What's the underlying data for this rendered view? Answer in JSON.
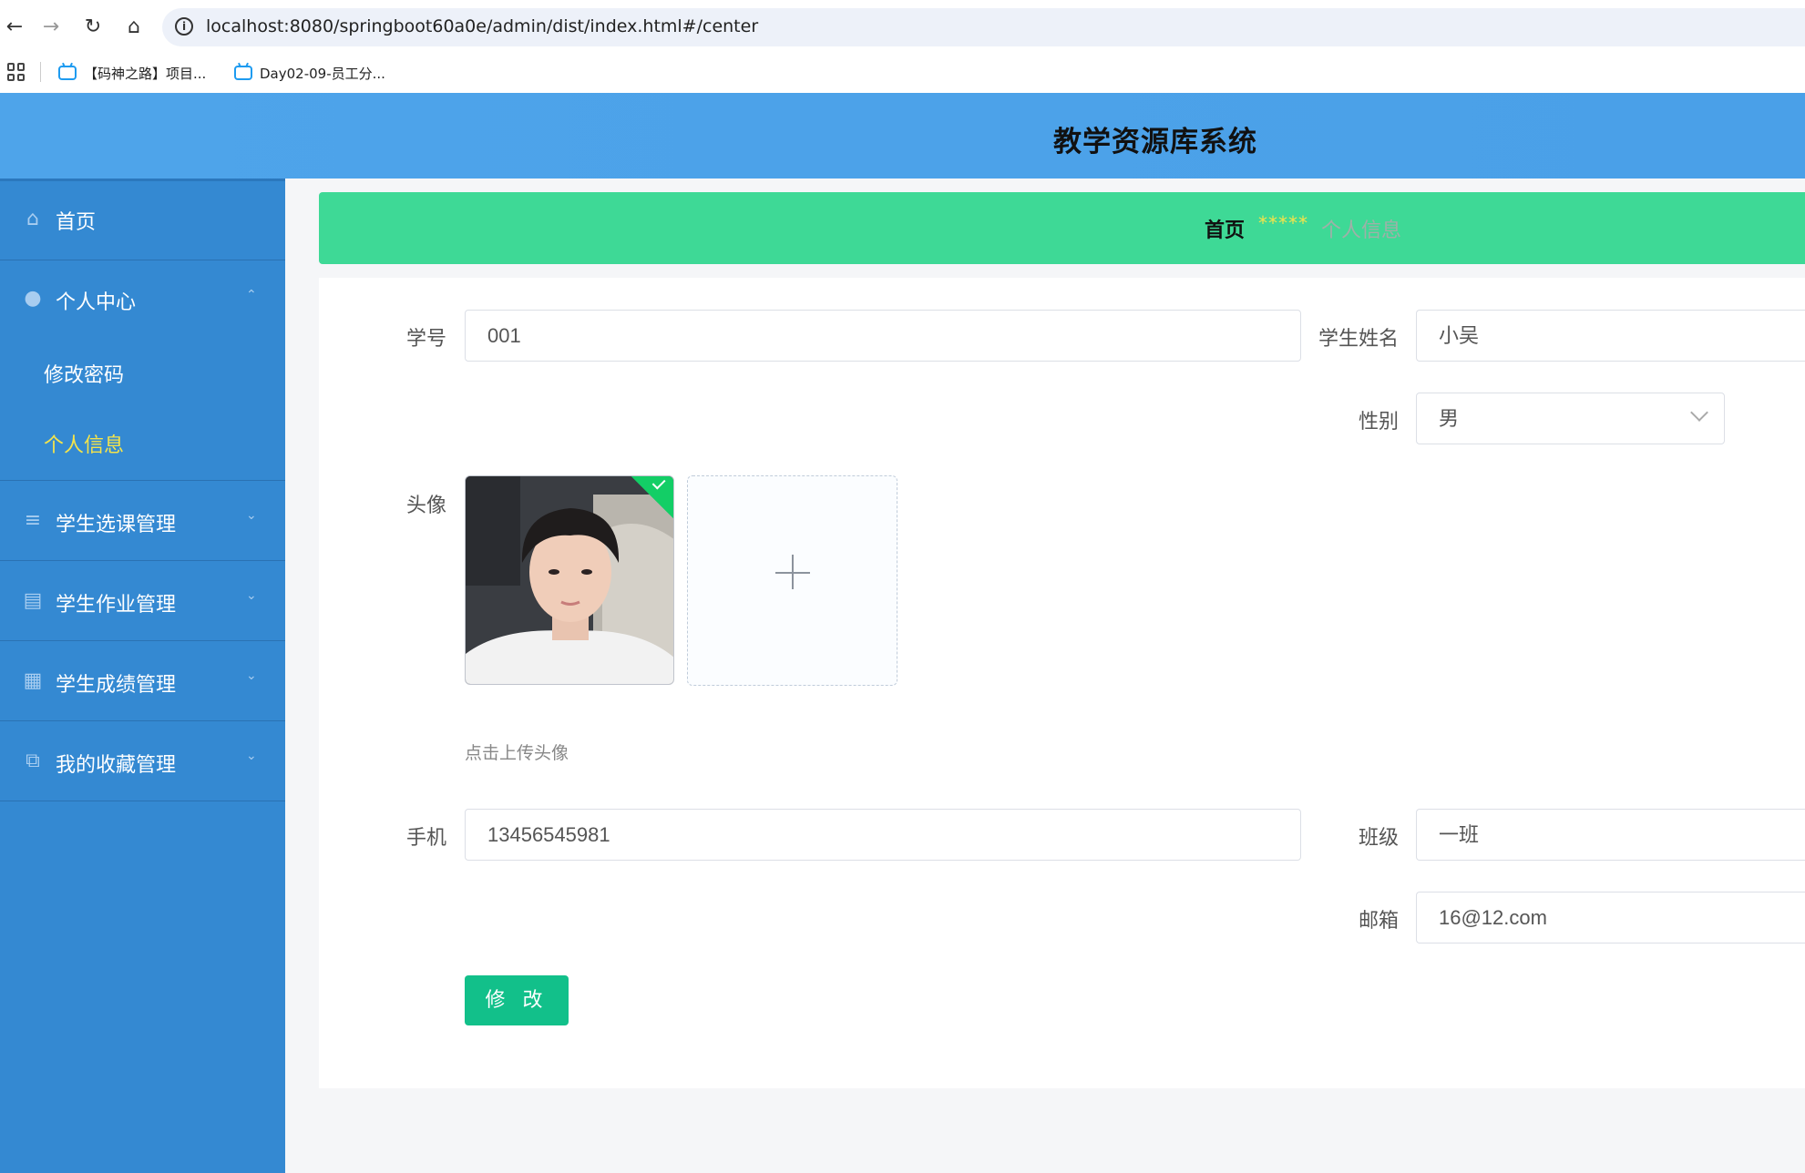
{
  "browser": {
    "url": "localhost:8080/springboot60a0e/admin/dist/index.html#/center",
    "bookmarks": [
      "【码神之路】项目...",
      "Day02-09-员工分..."
    ]
  },
  "header": {
    "title": "教学资源库系统"
  },
  "sidebar": {
    "items": [
      {
        "label": "首页",
        "icon": "home-icon"
      },
      {
        "label": "个人中心",
        "icon": "user-icon",
        "expanded": true,
        "children": [
          {
            "label": "修改密码"
          },
          {
            "label": "个人信息",
            "active": true
          }
        ]
      },
      {
        "label": "学生选课管理",
        "icon": "sliders-icon"
      },
      {
        "label": "学生作业管理",
        "icon": "clipboard-icon"
      },
      {
        "label": "学生成绩管理",
        "icon": "grid-icon"
      },
      {
        "label": "我的收藏管理",
        "icon": "copy-icon"
      }
    ]
  },
  "breadcrumb": {
    "home": "首页",
    "separator": "*****",
    "current": "个人信息"
  },
  "form": {
    "student_id": {
      "label": "学号",
      "value": "001"
    },
    "student_name": {
      "label": "学生姓名",
      "value": "小吴"
    },
    "gender": {
      "label": "性别",
      "value": "男"
    },
    "avatar": {
      "label": "头像",
      "tip": "点击上传头像"
    },
    "phone": {
      "label": "手机",
      "value": "13456545981"
    },
    "class": {
      "label": "班级",
      "value": "一班"
    },
    "email": {
      "label": "邮箱",
      "value": "16@12.com"
    },
    "submit_label": "修 改"
  },
  "colors": {
    "header": "#4aa0e8",
    "sidebar": "#3489d2",
    "breadcrumb": "#3ed996",
    "active_menu": "#f5e44a",
    "button": "#12c08a"
  }
}
